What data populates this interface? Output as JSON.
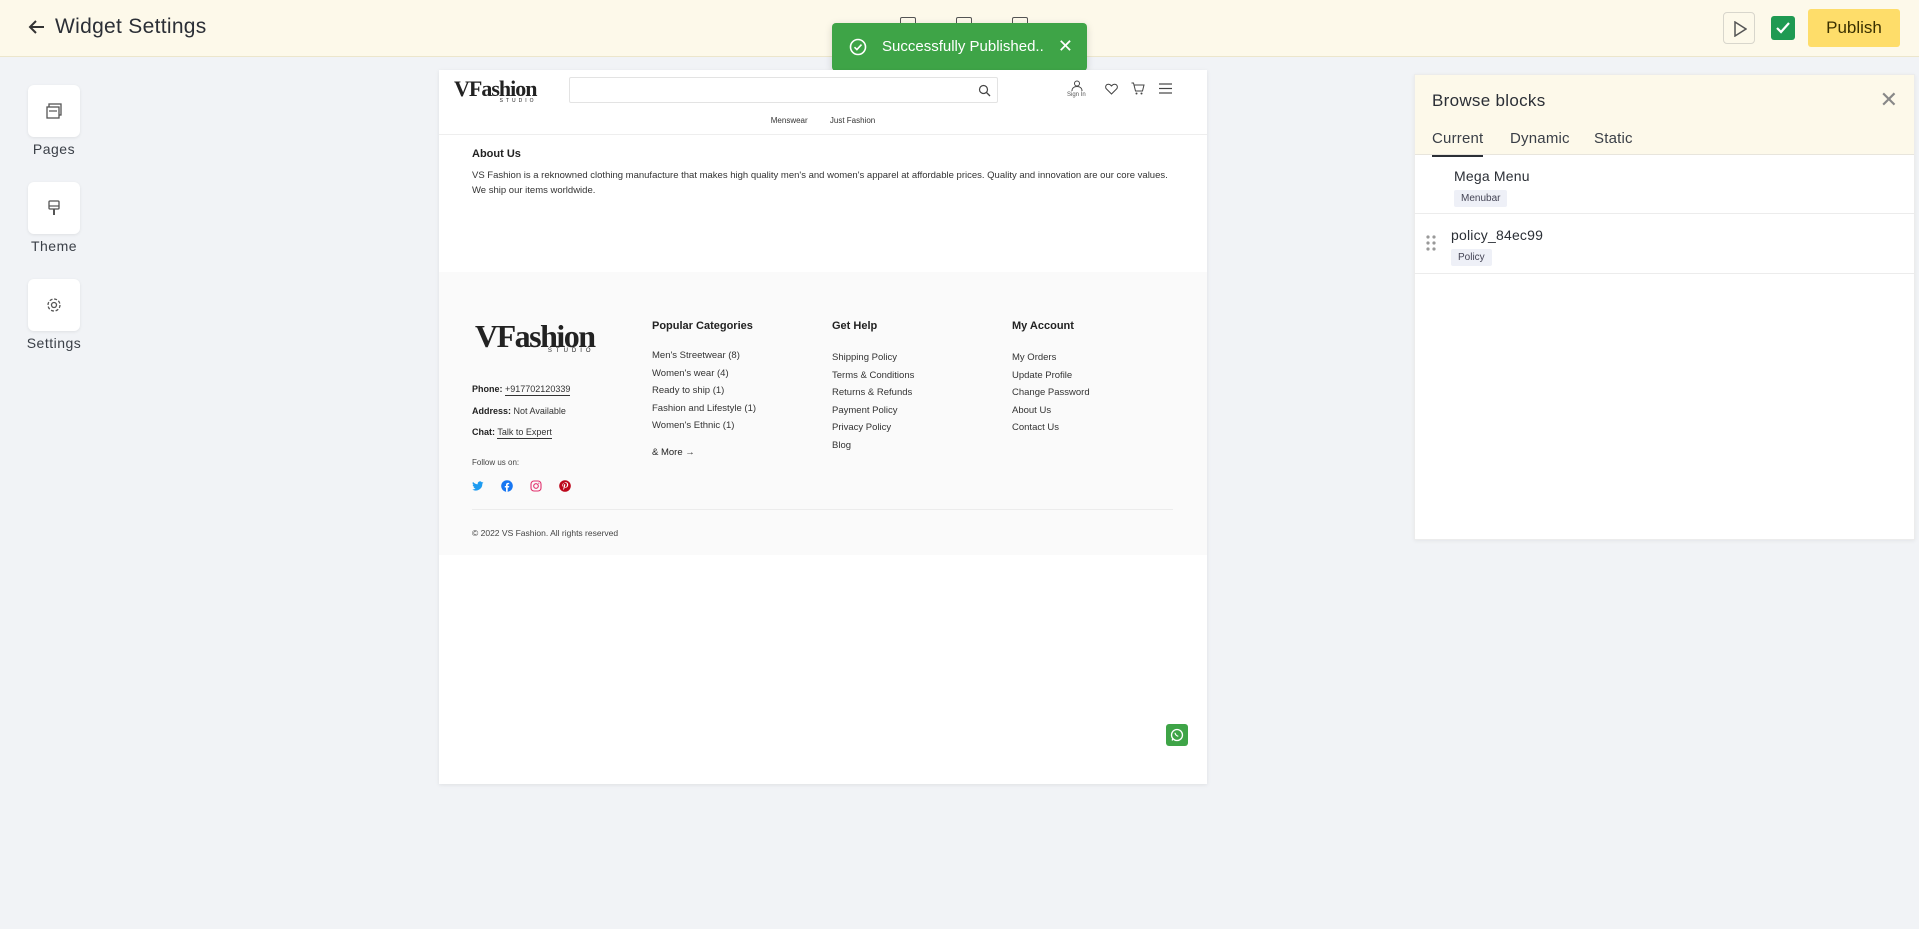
{
  "topbar": {
    "title": "Widget Settings",
    "publish_label": "Publish"
  },
  "toast": {
    "message": "Successfully Published.."
  },
  "sidebar": {
    "items": [
      {
        "label": "Pages",
        "icon": "pages-icon"
      },
      {
        "label": "Theme",
        "icon": "brush-icon"
      },
      {
        "label": "Settings",
        "icon": "gear-icon"
      }
    ]
  },
  "preview": {
    "logo": "VFashion",
    "logo_sub": "STUDIO",
    "search_placeholder": "",
    "sign_in": "Sign In",
    "nav": [
      "Menswear",
      "Just Fashion"
    ],
    "about": {
      "title": "About Us",
      "line1": "VS Fashion is a reknowned clothing manufacture that makes high quality men's and women's apparel at affordable prices. Quality and innovation are our core values.",
      "line2": "We ship our items worldwide."
    },
    "footer": {
      "phone_label": "Phone:",
      "phone": "+917702120339",
      "address_label": "Address:",
      "address": "Not Available",
      "chat_label": "Chat:",
      "chat": "Talk to Expert",
      "follow": "Follow us on:",
      "socials": [
        "twitter-icon",
        "facebook-icon",
        "instagram-icon",
        "pinterest-icon"
      ],
      "col1": {
        "title": "Popular Categories",
        "items": [
          "Men's Streetwear (8)",
          "Women's wear (4)",
          "Ready to ship (1)",
          "Fashion and Lifestyle (1)",
          "Women's Ethnic (1)"
        ],
        "more": "& More →"
      },
      "col2": {
        "title": "Get Help",
        "items": [
          "Shipping Policy",
          "Terms & Conditions",
          "Returns & Refunds",
          "Payment Policy",
          "Privacy Policy",
          "Blog"
        ]
      },
      "col3": {
        "title": "My Account",
        "items": [
          "My Orders",
          "Update Profile",
          "Change Password",
          "About Us",
          "Contact Us"
        ]
      },
      "copyright": "© 2022 VS Fashion. All rights reserved"
    }
  },
  "panel": {
    "title": "Browse blocks",
    "tabs": [
      "Current",
      "Dynamic",
      "Static"
    ],
    "active_tab": "Current",
    "blocks": [
      {
        "name": "Mega Menu",
        "badge": "Menubar"
      },
      {
        "name": "policy_84ec99",
        "badge": "Policy"
      }
    ]
  },
  "colors": {
    "topbar_bg": "#fdf9ea",
    "publish_bg": "#fedd6a",
    "toast_bg": "#3ea447",
    "check_bg": "#1f9a52"
  }
}
